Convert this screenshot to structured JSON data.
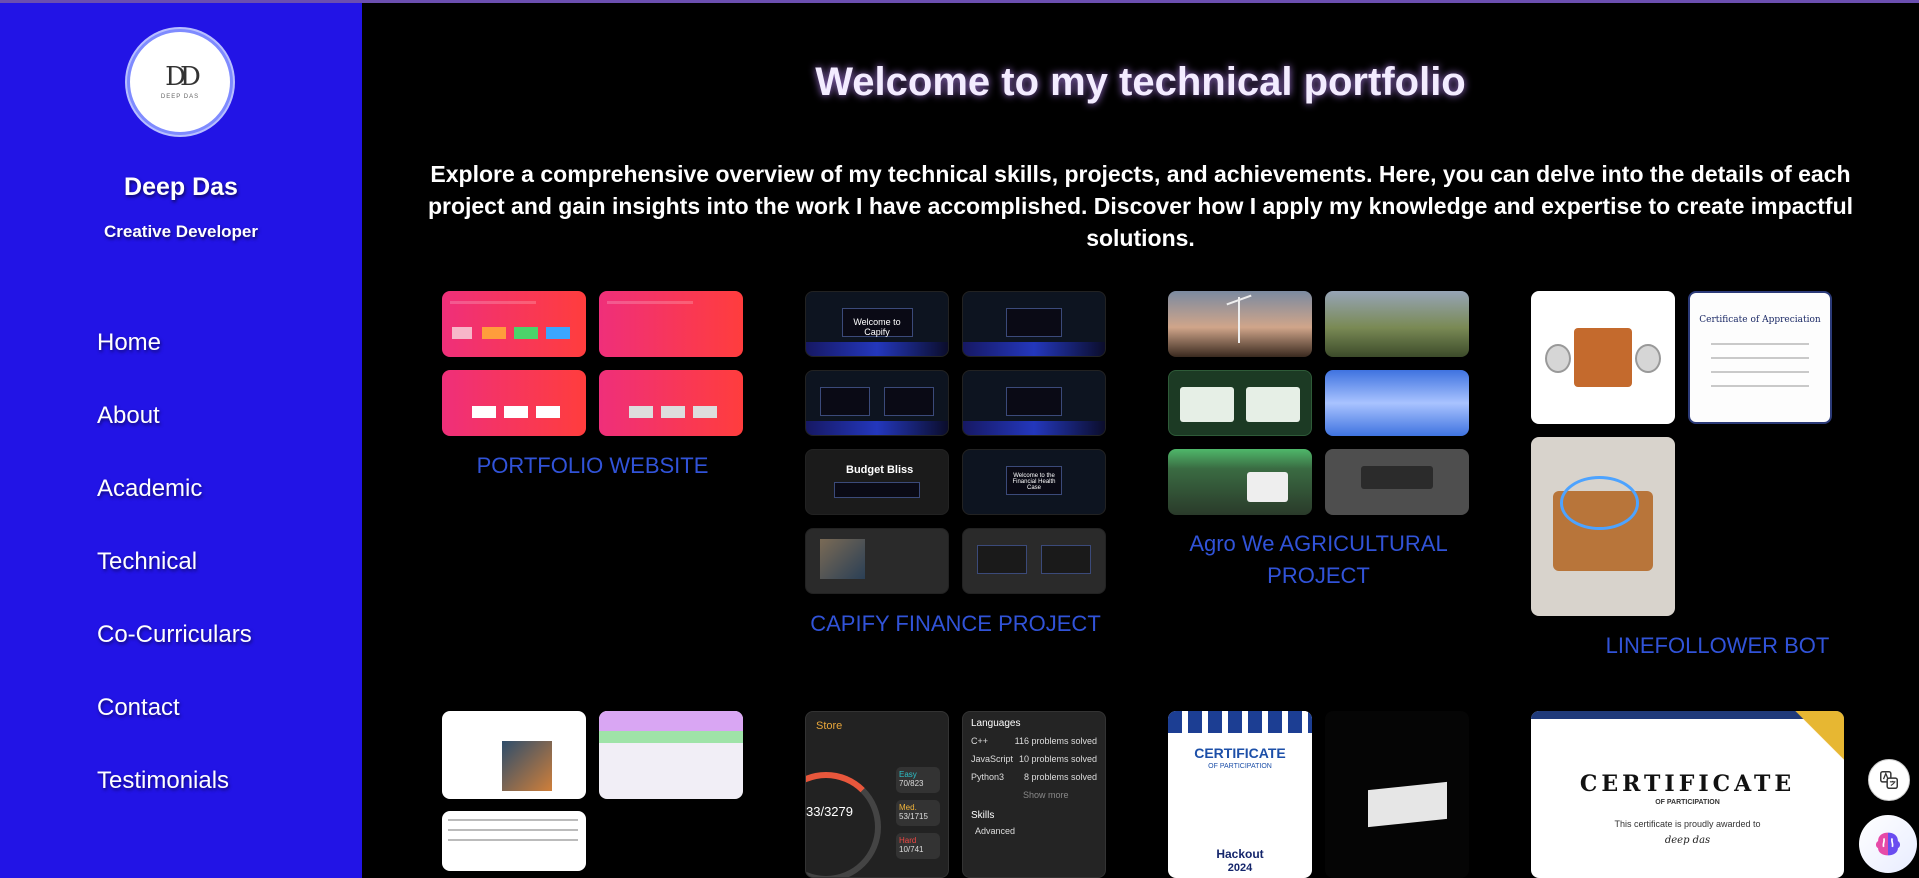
{
  "profile": {
    "name": "Deep Das",
    "role": "Creative Developer",
    "logo_monogram": "DD",
    "logo_text": "DEEP DAS"
  },
  "nav": {
    "items": [
      "Home",
      "About",
      "Academic",
      "Technical",
      "Co-Curriculars",
      "Contact",
      "Testimonials"
    ]
  },
  "main": {
    "title": "Welcome to my technical portfolio",
    "intro": "Explore a comprehensive overview of my technical skills, projects, and achievements. Here, you can delve into the details of each project and gain insights into the work I have accomplished. Discover how I apply my knowledge and expertise to create impactful solutions."
  },
  "projects": [
    {
      "title": "PORTFOLIO WEBSITE"
    },
    {
      "title": "CAPIFY FINANCE PROJECT",
      "thumb_text": [
        "Welcome to Capify",
        "Budget Bliss",
        "Welcome to the Financial Health Case"
      ]
    },
    {
      "title": "Agro We AGRICULTURAL PROJECT"
    },
    {
      "title": "LINEFOLLOWER BOT",
      "cert_text": "Certificate of Appreciation"
    }
  ],
  "row2": {
    "store": {
      "label": "Store",
      "solved": "33/3279",
      "easy": "Easy",
      "easy_val": "70/823",
      "med": "Med.",
      "med_val": "53/1715",
      "hard": "Hard",
      "hard_val": "10/741"
    },
    "languages": {
      "heading": "Languages",
      "items": [
        "C++",
        "JavaScript",
        "Python3"
      ],
      "counts": [
        "116 problems solved",
        "10 problems solved",
        "8 problems solved"
      ],
      "show_more": "Show more",
      "skills": "Skills",
      "advanced": "Advanced"
    },
    "hackout_cert": {
      "heading": "CERTIFICATE",
      "sub": "OF PARTICIPATION",
      "event": "Hackout",
      "year": "2024"
    },
    "participation_cert": {
      "heading": "CERTIFICATE",
      "sub": "OF PARTICIPATION",
      "line": "This certificate is proudly awarded to",
      "recipient": "deep das"
    }
  },
  "colors": {
    "sidebar": "#2214e6",
    "accent_title": "#3153d8",
    "background": "#000000"
  },
  "floating": {
    "translate_icon": "translate-icon",
    "assistant_icon": "brain-icon"
  }
}
